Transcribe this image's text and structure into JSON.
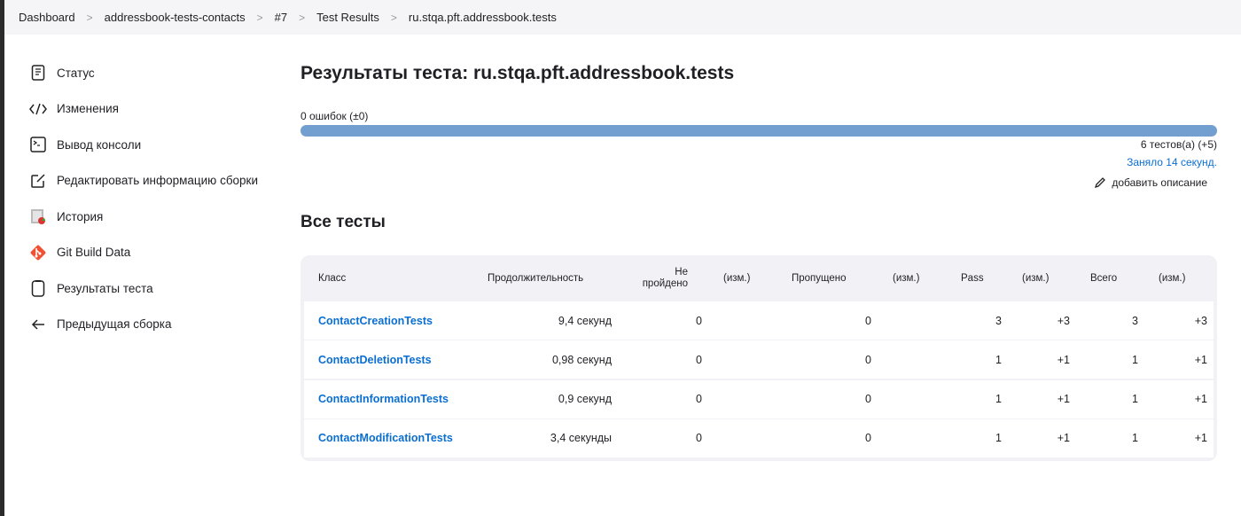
{
  "breadcrumbs": [
    "Dashboard",
    "addressbook-tests-contacts",
    "#7",
    "Test Results",
    "ru.stqa.pft.addressbook.tests"
  ],
  "sidebar": {
    "items": [
      {
        "label": "Статус",
        "icon": "status-icon"
      },
      {
        "label": "Изменения",
        "icon": "code-icon"
      },
      {
        "label": "Вывод консоли",
        "icon": "terminal-icon"
      },
      {
        "label": "Редактировать информацию сборки",
        "icon": "edit-icon"
      },
      {
        "label": "История",
        "icon": "history-icon"
      },
      {
        "label": "Git Build Data",
        "icon": "git-icon"
      },
      {
        "label": "Результаты теста",
        "icon": "clipboard-icon"
      },
      {
        "label": "Предыдущая сборка",
        "icon": "arrow-left-icon"
      }
    ]
  },
  "main": {
    "title": "Результаты теста: ru.stqa.pft.addressbook.tests",
    "failures": "0 ошибок (±0)",
    "progress_pass_percent": 100,
    "total": "6 тестов(а) (+5)",
    "took": "Заняло 14 секунд.",
    "add_description": "добавить описание",
    "all_tests": "Все тесты",
    "colors": {
      "bar": "#729fcf",
      "link": "#0b6ed1"
    }
  },
  "table": {
    "headers": [
      "Класс",
      "Продолжительность",
      "Не пройдено",
      "(изм.)",
      "Пропущено",
      "(изм.)",
      "Pass",
      "(изм.)",
      "Всего",
      "(изм.)"
    ],
    "header_fail_lines": [
      "Не",
      "пройдено"
    ],
    "rows": [
      [
        "ContactCreationTests",
        "9,4 секунд",
        "0",
        "",
        "0",
        "",
        "3",
        "+3",
        "3",
        "+3"
      ],
      [
        "ContactDeletionTests",
        "0,98 секунд",
        "0",
        "",
        "0",
        "",
        "1",
        "+1",
        "1",
        "+1"
      ],
      [
        "ContactInformationTests",
        "0,9 секунд",
        "0",
        "",
        "0",
        "",
        "1",
        "+1",
        "1",
        "+1"
      ],
      [
        "ContactModificationTests",
        "3,4 секунды",
        "0",
        "",
        "0",
        "",
        "1",
        "+1",
        "1",
        "+1"
      ]
    ]
  }
}
